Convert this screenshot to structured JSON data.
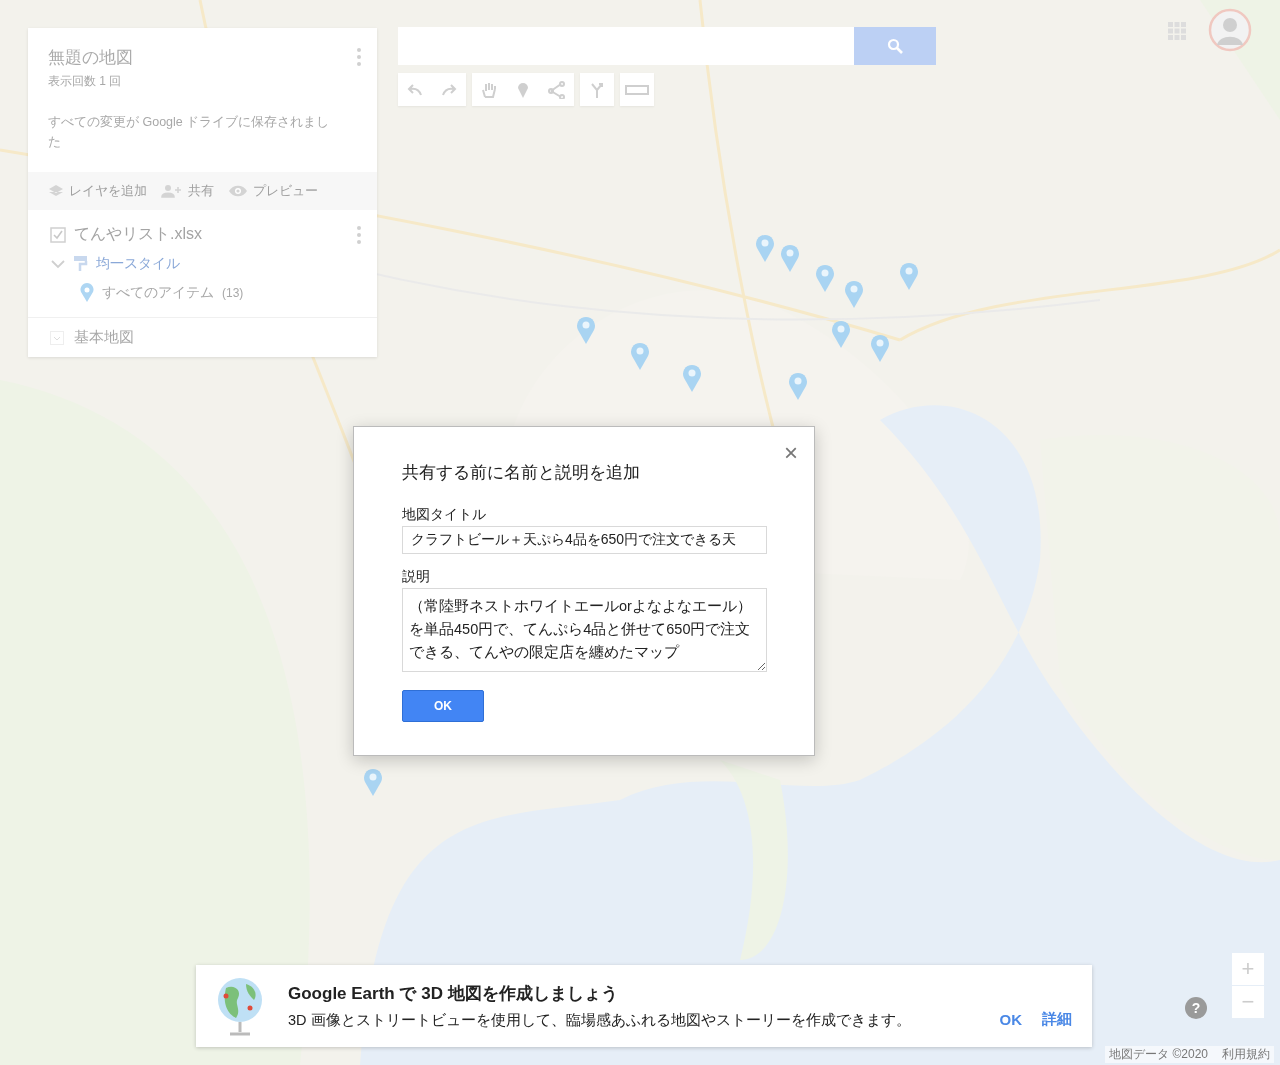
{
  "map_panel": {
    "title": "無題の地図",
    "views": "表示回数 1 回",
    "save_status": "すべての変更が Google ドライブに保存されました",
    "actions": [
      {
        "kind": "layer",
        "label": "レイヤを追加"
      },
      {
        "kind": "share",
        "label": "共有"
      },
      {
        "kind": "preview",
        "label": "プレビュー"
      }
    ],
    "layer": {
      "name": "てんやリスト.xlsx",
      "checked": true,
      "expanded": true,
      "style": "均一スタイル",
      "items_label": "すべてのアイテム",
      "items_count": "(13)"
    },
    "base_map": {
      "label": "基本地図",
      "expanded": false
    }
  },
  "toolbar": [
    {
      "kind": "undo"
    },
    {
      "kind": "redo"
    },
    {
      "kind": "hand"
    },
    {
      "kind": "marker"
    },
    {
      "kind": "line"
    },
    {
      "kind": "route"
    },
    {
      "kind": "ruler"
    }
  ],
  "dialog": {
    "title": "共有する前に名前と説明を追加",
    "close": "×",
    "fields": [
      {
        "kind": "input",
        "label": "地図タイトル",
        "value": "クラフトビール＋天ぷら4品を650円で注文できる天"
      },
      {
        "kind": "textarea",
        "label": "説明",
        "value": "（常陸野ネストホワイトエールorよなよなエール）を単品450円で、てんぷら4品と併せて650円で注文できる、てんやの限定店を纏めたマップ"
      }
    ],
    "ok": "OK"
  },
  "banner": {
    "title": "Google Earth で 3D 地図を作成しましょう",
    "text": "3D 画像とストリートビューを使用して、臨場感あふれる地図やストーリーを作成できます。",
    "actions": [
      "OK",
      "詳細"
    ]
  },
  "map_controls": {
    "zoom_in": "+",
    "zoom_out": "−",
    "help": "?"
  },
  "footer": [
    "地図データ ©2020",
    "利用規約"
  ]
}
